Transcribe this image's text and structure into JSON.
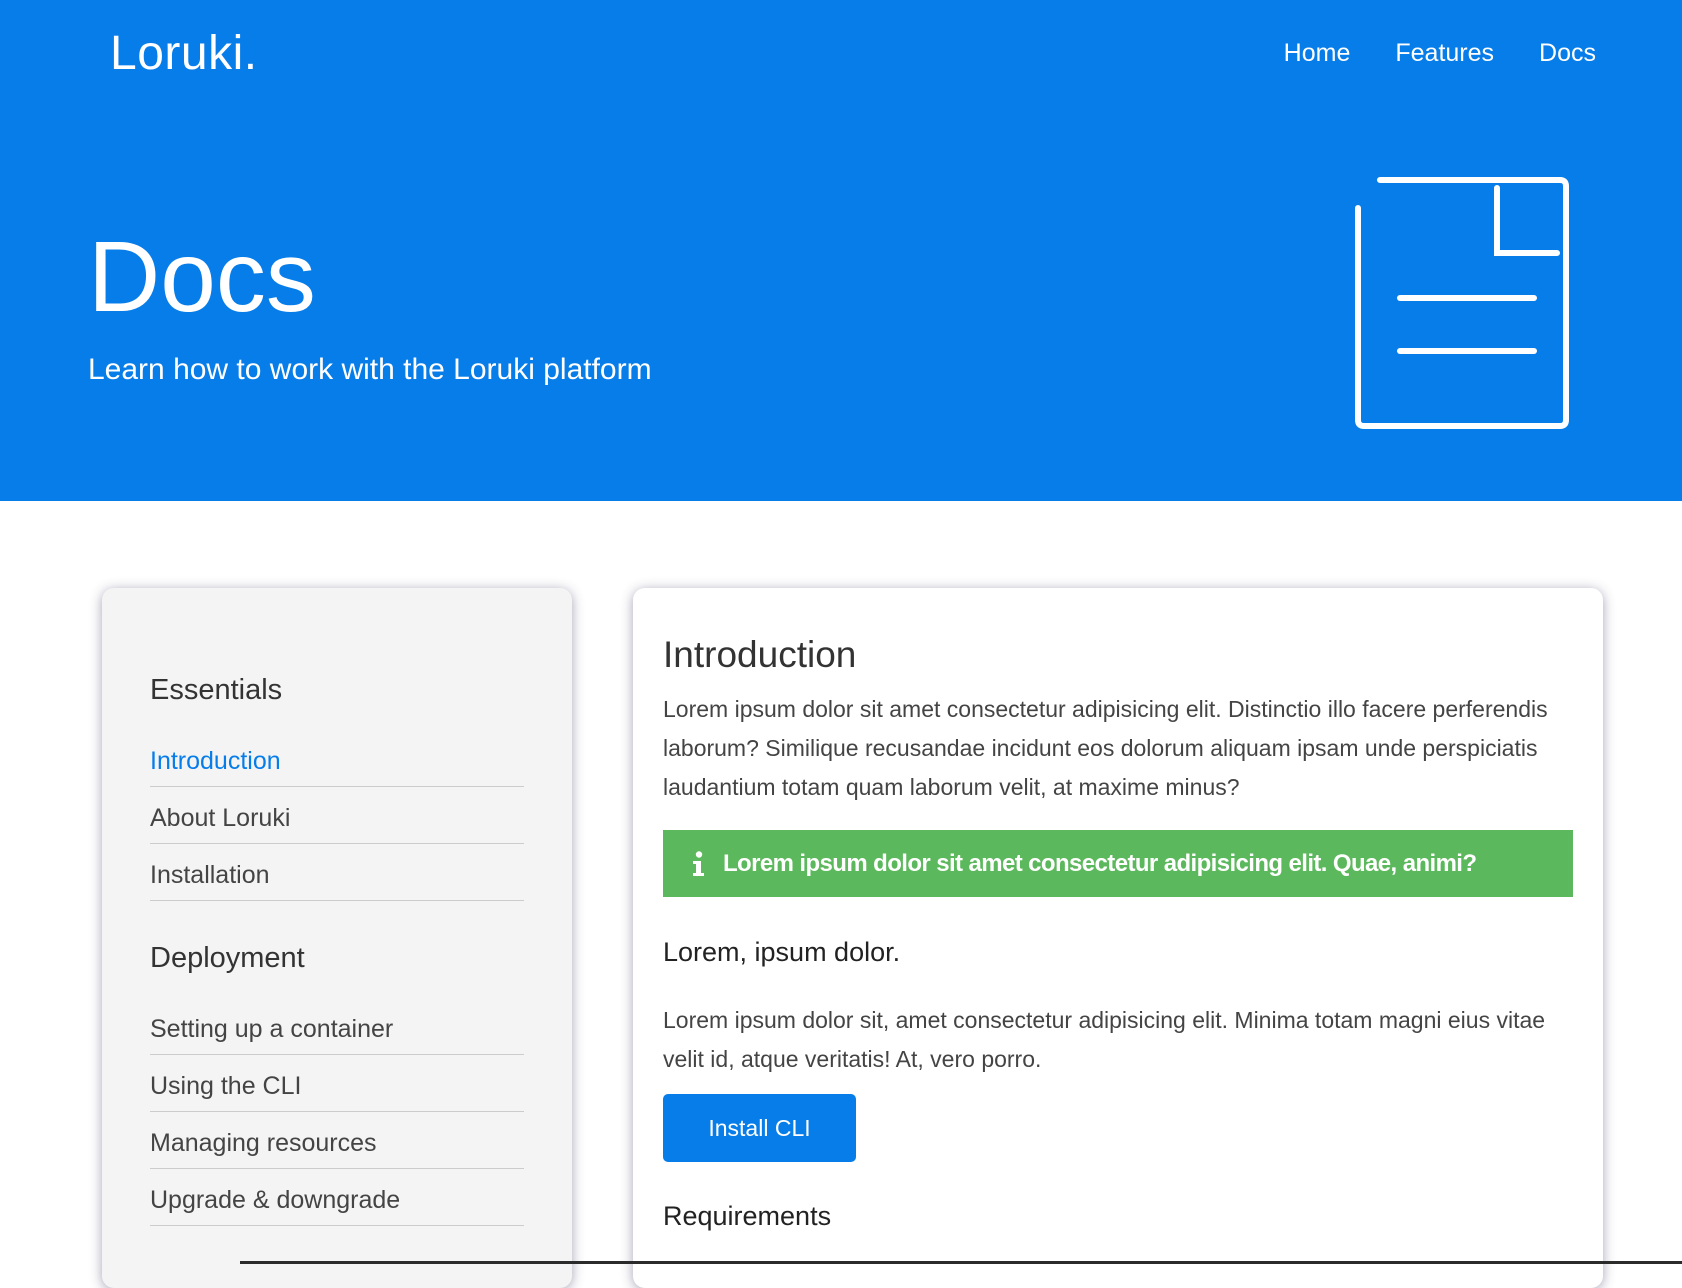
{
  "header": {
    "brand": "Loruki.",
    "nav": [
      "Home",
      "Features",
      "Docs"
    ],
    "title": "Docs",
    "subtitle": "Learn how to work with the Loruki platform",
    "icon": "document-icon",
    "color": "#077de9"
  },
  "sidebar": {
    "sections": [
      {
        "heading": "Essentials",
        "items": [
          "Introduction",
          "About Loruki",
          "Installation"
        ]
      },
      {
        "heading": "Deployment",
        "items": [
          "Setting up a container",
          "Using the CLI",
          "Managing resources",
          "Upgrade & downgrade"
        ]
      }
    ],
    "active_item": "Introduction"
  },
  "main": {
    "title": "Introduction",
    "paragraph_1": "Lorem ipsum dolor sit amet consectetur adipisicing elit. Distinctio illo facere perferendis laborum? Similique recusandae incidunt eos dolorum aliquam ipsam unde perspiciatis laudantium totam quam laborum velit, at maxime minus?",
    "alert": {
      "icon": "info-icon",
      "text": "Lorem ipsum dolor sit amet consectetur adipisicing elit. Quae, animi?",
      "color": "#5cb85c"
    },
    "subheading": "Lorem, ipsum dolor.",
    "paragraph_2": "Lorem ipsum dolor sit, amet consectetur adipisicing elit. Minima totam magni eius vitae velit id, atque veritatis! At, vero porro.",
    "install_button": "Install CLI",
    "requirements_heading": "Requirements"
  }
}
